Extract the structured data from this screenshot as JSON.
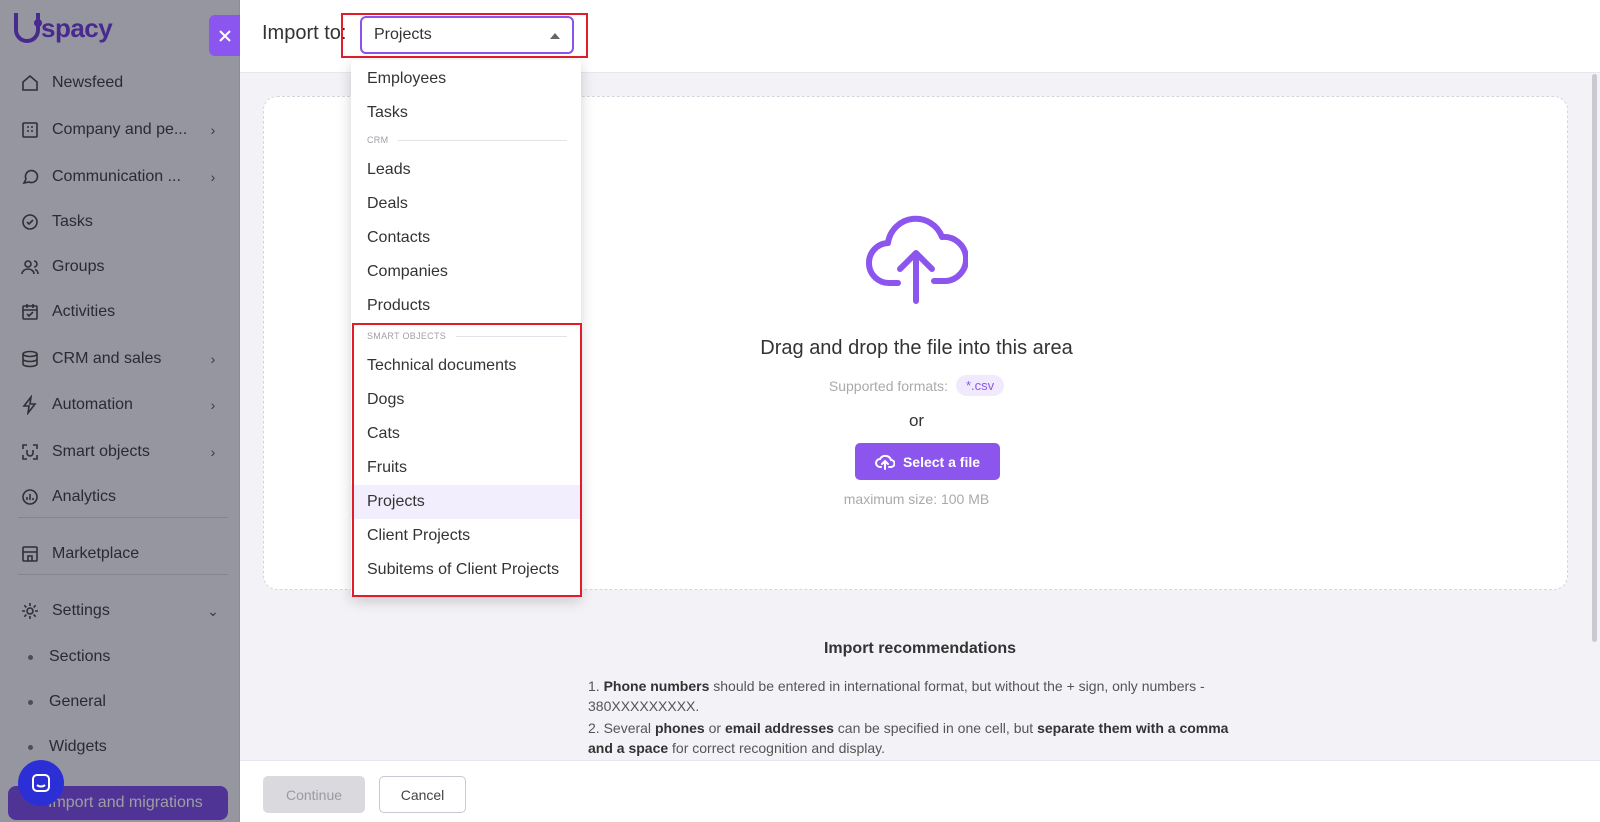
{
  "sidebar": {
    "logo": "spacy",
    "items": [
      {
        "label": "Newsfeed",
        "icon": "home-icon",
        "chevron": false
      },
      {
        "label": "Company and pe...",
        "icon": "building-icon",
        "chevron": true
      },
      {
        "label": "Communication ...",
        "icon": "chat-icon",
        "chevron": true
      },
      {
        "label": "Tasks",
        "icon": "check-circle-icon",
        "chevron": false
      },
      {
        "label": "Groups",
        "icon": "users-icon",
        "chevron": false
      },
      {
        "label": "Activities",
        "icon": "calendar-icon",
        "chevron": false
      },
      {
        "label": "CRM and sales",
        "icon": "database-icon",
        "chevron": true
      },
      {
        "label": "Automation",
        "icon": "lightning-icon",
        "chevron": true
      },
      {
        "label": "Smart objects",
        "icon": "smart-object-icon",
        "chevron": true
      },
      {
        "label": "Analytics",
        "icon": "chart-icon",
        "chevron": false
      },
      {
        "label": "Marketplace",
        "icon": "store-icon",
        "chevron": false
      },
      {
        "label": "Settings",
        "icon": "gear-icon",
        "chevron": "down"
      }
    ],
    "sub_items": [
      "Sections",
      "General",
      "Widgets",
      "Import and migrations"
    ]
  },
  "header": {
    "import_label": "Import to:",
    "select_value": "Projects"
  },
  "dropdown": {
    "items_top": [
      "Employees",
      "Tasks"
    ],
    "group_crm": "CRM",
    "items_crm": [
      "Leads",
      "Deals",
      "Contacts",
      "Companies",
      "Products"
    ],
    "group_smart": "SMART OBJECTS",
    "items_smart": [
      "Technical documents",
      "Dogs",
      "Cats",
      "Fruits",
      "Projects",
      "Client Projects",
      "Subitems of Client Projects"
    ],
    "selected": "Projects"
  },
  "dropzone": {
    "title": "Drag and drop the file into this area",
    "formats_label": "Supported formats:",
    "formats_badge": "*.csv",
    "or": "or",
    "select_button": "Select a file",
    "max_size": "maximum size: 100 MB"
  },
  "recommendations": {
    "title": "Import recommendations",
    "r1_num": "1. ",
    "r1_b1": "Phone numbers",
    "r1_t1": " should be entered in international format, but without the + sign, only numbers - 380XXXXXXXXX.",
    "r2_num": "2. Several ",
    "r2_b1": "phones",
    "r2_t1": " or ",
    "r2_b2": "email addresses",
    "r2_t2": " can be specified in one cell, but ",
    "r2_b3": "separate them with a comma and a space",
    "r2_t3": " for correct recognition and display."
  },
  "footer": {
    "continue": "Continue",
    "cancel": "Cancel"
  },
  "colors": {
    "accent": "#8b55ee",
    "highlight_red": "#e01e2b",
    "selected_bg": "#f3eefe"
  }
}
